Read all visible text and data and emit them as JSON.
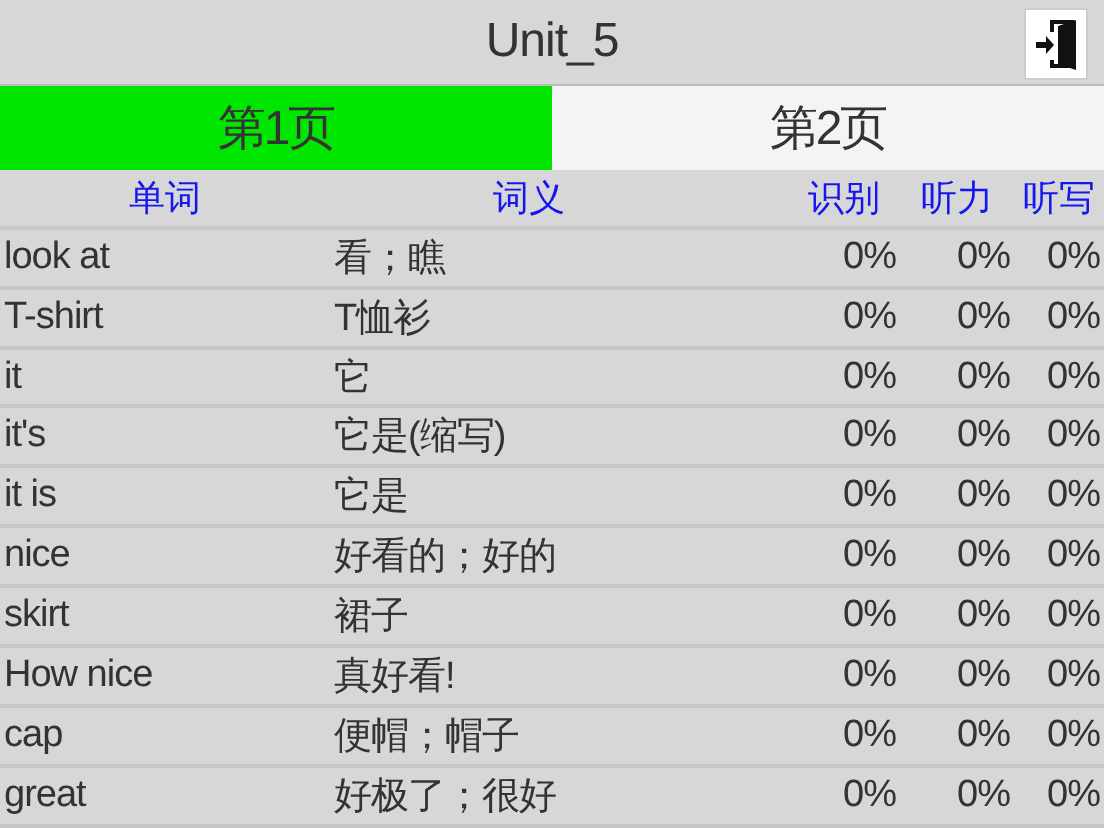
{
  "title": "Unit_5",
  "tabs": [
    {
      "label": "第1页",
      "selected": true
    },
    {
      "label": "第2页",
      "selected": false
    }
  ],
  "columns": [
    "单词",
    "词义",
    "识别",
    "听力",
    "听写"
  ],
  "rows": [
    {
      "word": "look at",
      "meaning": "看；瞧",
      "recognize": "0%",
      "listening": "0%",
      "dictation": "0%"
    },
    {
      "word": "T-shirt",
      "meaning": "T恤衫",
      "recognize": "0%",
      "listening": "0%",
      "dictation": "0%"
    },
    {
      "word": "it",
      "meaning": "它",
      "recognize": "0%",
      "listening": "0%",
      "dictation": "0%"
    },
    {
      "word": "it's",
      "meaning": "它是(缩写)",
      "recognize": "0%",
      "listening": "0%",
      "dictation": "0%"
    },
    {
      "word": "it is",
      "meaning": "它是",
      "recognize": "0%",
      "listening": "0%",
      "dictation": "0%"
    },
    {
      "word": "nice",
      "meaning": "好看的；好的",
      "recognize": "0%",
      "listening": "0%",
      "dictation": "0%"
    },
    {
      "word": "skirt",
      "meaning": "裙子",
      "recognize": "0%",
      "listening": "0%",
      "dictation": "0%"
    },
    {
      "word": "How nice",
      "meaning": "真好看!",
      "recognize": "0%",
      "listening": "0%",
      "dictation": "0%"
    },
    {
      "word": "cap",
      "meaning": "便帽；帽子",
      "recognize": "0%",
      "listening": "0%",
      "dictation": "0%"
    },
    {
      "word": "great",
      "meaning": "好极了；很好",
      "recognize": "0%",
      "listening": "0%",
      "dictation": "0%"
    }
  ]
}
